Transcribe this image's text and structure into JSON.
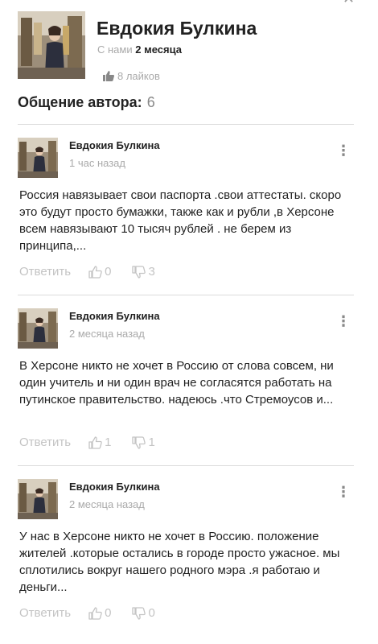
{
  "profile": {
    "name": "Евдокия Булкина",
    "since_label": "С нами",
    "since_value": "2 месяца",
    "likes": "8 лайков"
  },
  "section": {
    "title": "Общение автора:",
    "count": "6"
  },
  "comments": [
    {
      "author": "Евдокия Булкина",
      "time": "1 час назад",
      "text": "Россия навязывает свои паспорта .свои аттестаты. скоро это будут просто бумажки, также как и рубли ,в Херсоне всем навязывают 10 тысяч рублей . не берем из принципа,...",
      "reply_label": "Ответить",
      "upvotes": "0",
      "downvotes": "3"
    },
    {
      "author": "Евдокия Булкина",
      "time": "2 месяца назад",
      "text": "В Херсоне никто не хочет в Россию от слова совсем, ни один учитель и ни один врач не согласятся работать на путинское правительство. надеюсь .что Стремоусов и...",
      "reply_label": "Ответить",
      "upvotes": "1",
      "downvotes": "1"
    },
    {
      "author": "Евдокия Булкина",
      "time": "2 месяца назад",
      "text": "У нас в Херсоне никто не хочет в Россию. положение жителей .которые остались в городе просто ужасное. мы сплотились вокруг нашего родного мэра .я работаю и деньги...",
      "reply_label": "Ответить",
      "upvotes": "0",
      "downvotes": "0"
    }
  ]
}
